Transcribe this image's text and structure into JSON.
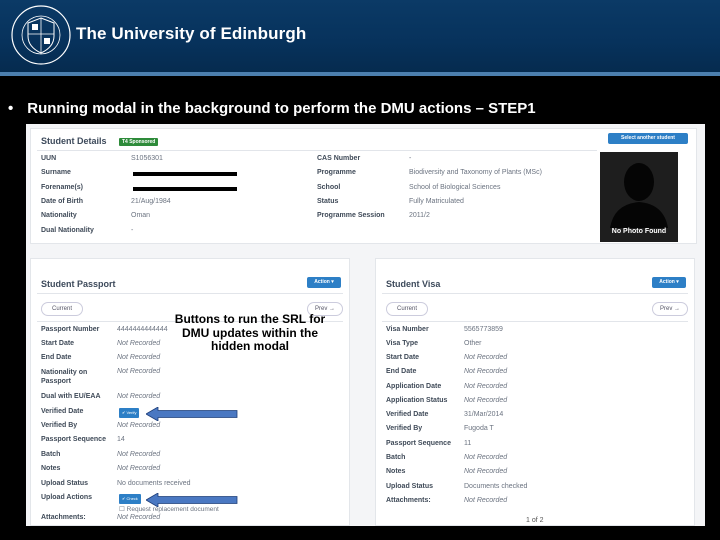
{
  "header": {
    "university_name": "The University of Edinburgh",
    "crest_text": "THE UNIVERSITY of EDINBURGH"
  },
  "slide": {
    "bullet": "•",
    "title": "Running modal in the background to perform the DMU actions – STEP1"
  },
  "student_details": {
    "title": "Student Details",
    "badge": "T4 Sponsored",
    "button": "Select another student",
    "left_rows": [
      {
        "label": "UUN",
        "value": "S1056301"
      },
      {
        "label": "Surname",
        "value": ""
      },
      {
        "label": "Forename(s)",
        "value": ""
      },
      {
        "label": "Date of Birth",
        "value": "21/Aug/1984"
      },
      {
        "label": "Nationality",
        "value": "Oman"
      },
      {
        "label": "Dual Nationality",
        "value": "-"
      }
    ],
    "right_rows": [
      {
        "label": "CAS Number",
        "value": "-"
      },
      {
        "label": "Programme",
        "value": "Biodiversity and Taxonomy of Plants (MSc)"
      },
      {
        "label": "School",
        "value": "School of Biological Sciences"
      },
      {
        "label": "Status",
        "value": "Fully Matriculated"
      },
      {
        "label": "Programme Session",
        "value": "2011/2"
      }
    ],
    "photo_caption": "No Photo Found"
  },
  "student_passport": {
    "title": "Student Passport",
    "action_button": "Action ▾",
    "current_button": "Current",
    "prev_button": "Prev →",
    "rows": [
      {
        "label": "Passport Number",
        "value": "4444444444444"
      },
      {
        "label": "Start Date",
        "value": "Not Recorded"
      },
      {
        "label": "End Date",
        "value": "Not Recorded"
      },
      {
        "label": "Nationality on Passport",
        "value": "Not Recorded"
      },
      {
        "label": "Dual with EU/EAA",
        "value": "Not Recorded"
      },
      {
        "label": "Verified Date",
        "value": ""
      },
      {
        "label": "Verified By",
        "value": "Not Recorded"
      },
      {
        "label": "Passport Sequence",
        "value": "14"
      },
      {
        "label": "Batch",
        "value": "Not Recorded"
      },
      {
        "label": "Notes",
        "value": "Not Recorded"
      },
      {
        "label": "Upload Status",
        "value": "No documents received"
      },
      {
        "label": "Upload Actions",
        "value": ""
      },
      {
        "label": "Attachments:",
        "value": "Not Recorded"
      }
    ],
    "verify_button": "Verify",
    "check_button": "Check",
    "request_text": "Request replacement document"
  },
  "student_visa": {
    "title": "Student Visa",
    "action_button": "Action ▾",
    "current_button": "Current",
    "prev_button": "Prev →",
    "rows": [
      {
        "label": "Visa Number",
        "value": "5565773859"
      },
      {
        "label": "Visa Type",
        "value": "Other"
      },
      {
        "label": "Start Date",
        "value": "Not Recorded"
      },
      {
        "label": "End Date",
        "value": "Not Recorded"
      },
      {
        "label": "Application Date",
        "value": "Not Recorded"
      },
      {
        "label": "Application Status",
        "value": "Not Recorded"
      },
      {
        "label": "Verified Date",
        "value": "31/Mar/2014"
      },
      {
        "label": "Verified By",
        "value": "Fugoda T"
      },
      {
        "label": "Passport Sequence",
        "value": "11"
      },
      {
        "label": "Batch",
        "value": "Not Recorded"
      },
      {
        "label": "Notes",
        "value": "Not Recorded"
      },
      {
        "label": "Upload Status",
        "value": "Documents checked"
      },
      {
        "label": "Attachments:",
        "value": "Not Recorded"
      }
    ]
  },
  "callout": "Buttons to run the SRL for DMU updates within the hidden modal",
  "pager": "1 of 2",
  "colors": {
    "header_bg": "#07325c",
    "accent_blue": "#2d7fc6",
    "badge_green": "#2e8b3a",
    "arrow_blue": "#4a78c2"
  }
}
